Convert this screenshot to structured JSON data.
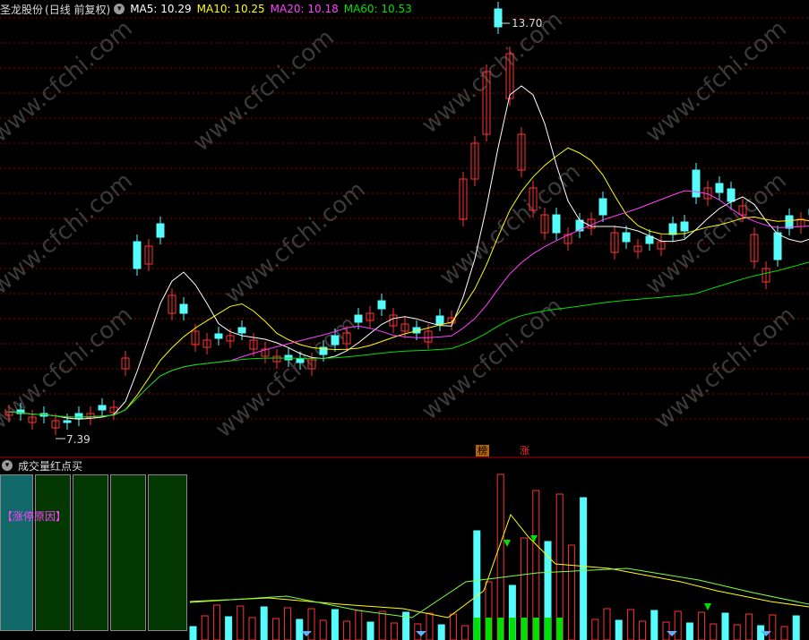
{
  "header": {
    "stock_name": "圣龙股份",
    "mode": "(日线 前复权)",
    "ma5": "MA5: 10.29",
    "ma10": "MA10: 10.25",
    "ma20": "MA20: 10.18",
    "ma60": "MA60: 10.53"
  },
  "colors": {
    "background": "#000000",
    "up": "#ff3232",
    "down": "#54fcfc",
    "ma5": "#ffffff",
    "ma10": "#ffff00",
    "ma20": "#ff40ff",
    "ma60": "#00e000",
    "grid": "#8b0000"
  },
  "annotations": {
    "high_label": "13.70",
    "low_label": "7.39",
    "tag_bang": "榜",
    "tag_zhang": "涨"
  },
  "watermark": "www.cfchi.com",
  "subpanel": {
    "title": "成交量红点买",
    "reason_label": "【涨停原因】"
  },
  "chart_data": {
    "type": "candlestick",
    "high": 13.7,
    "low": 7.39,
    "moving_averages": [
      "MA5",
      "MA10",
      "MA20",
      "MA60"
    ]
  }
}
